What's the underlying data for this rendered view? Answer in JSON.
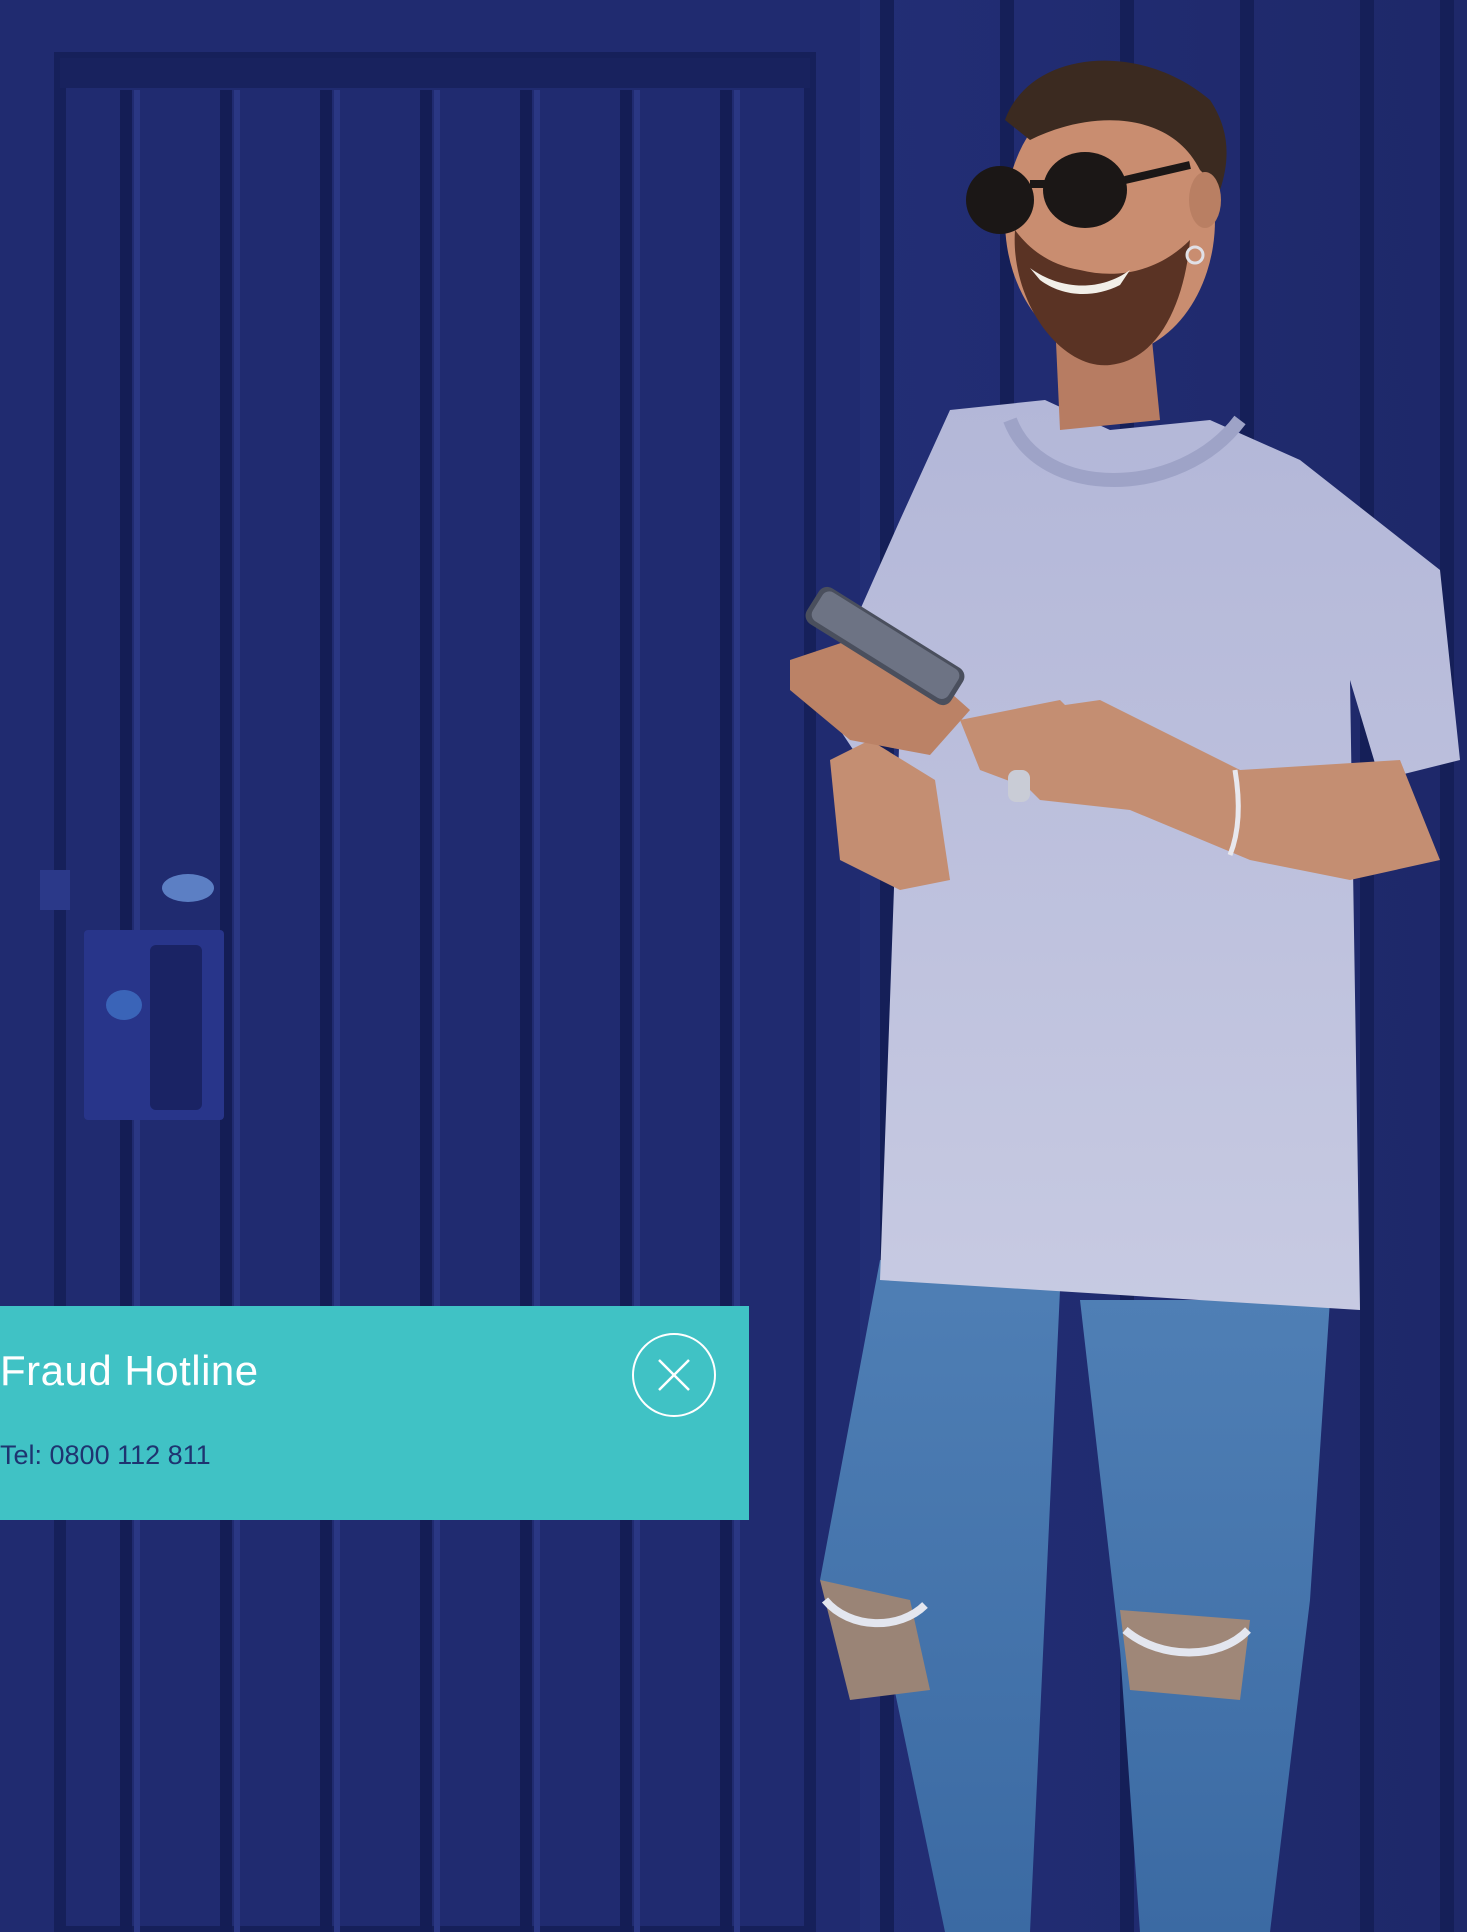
{
  "hero": {
    "background_color": "#1f2a6e",
    "image_subject": "man-with-smartphone-photo"
  },
  "hotline_card": {
    "title": "Fraud Hotline",
    "phone": "Tel: 0800 112 811",
    "accent_color": "#40c2c5",
    "close_icon": "close-circle-icon"
  }
}
